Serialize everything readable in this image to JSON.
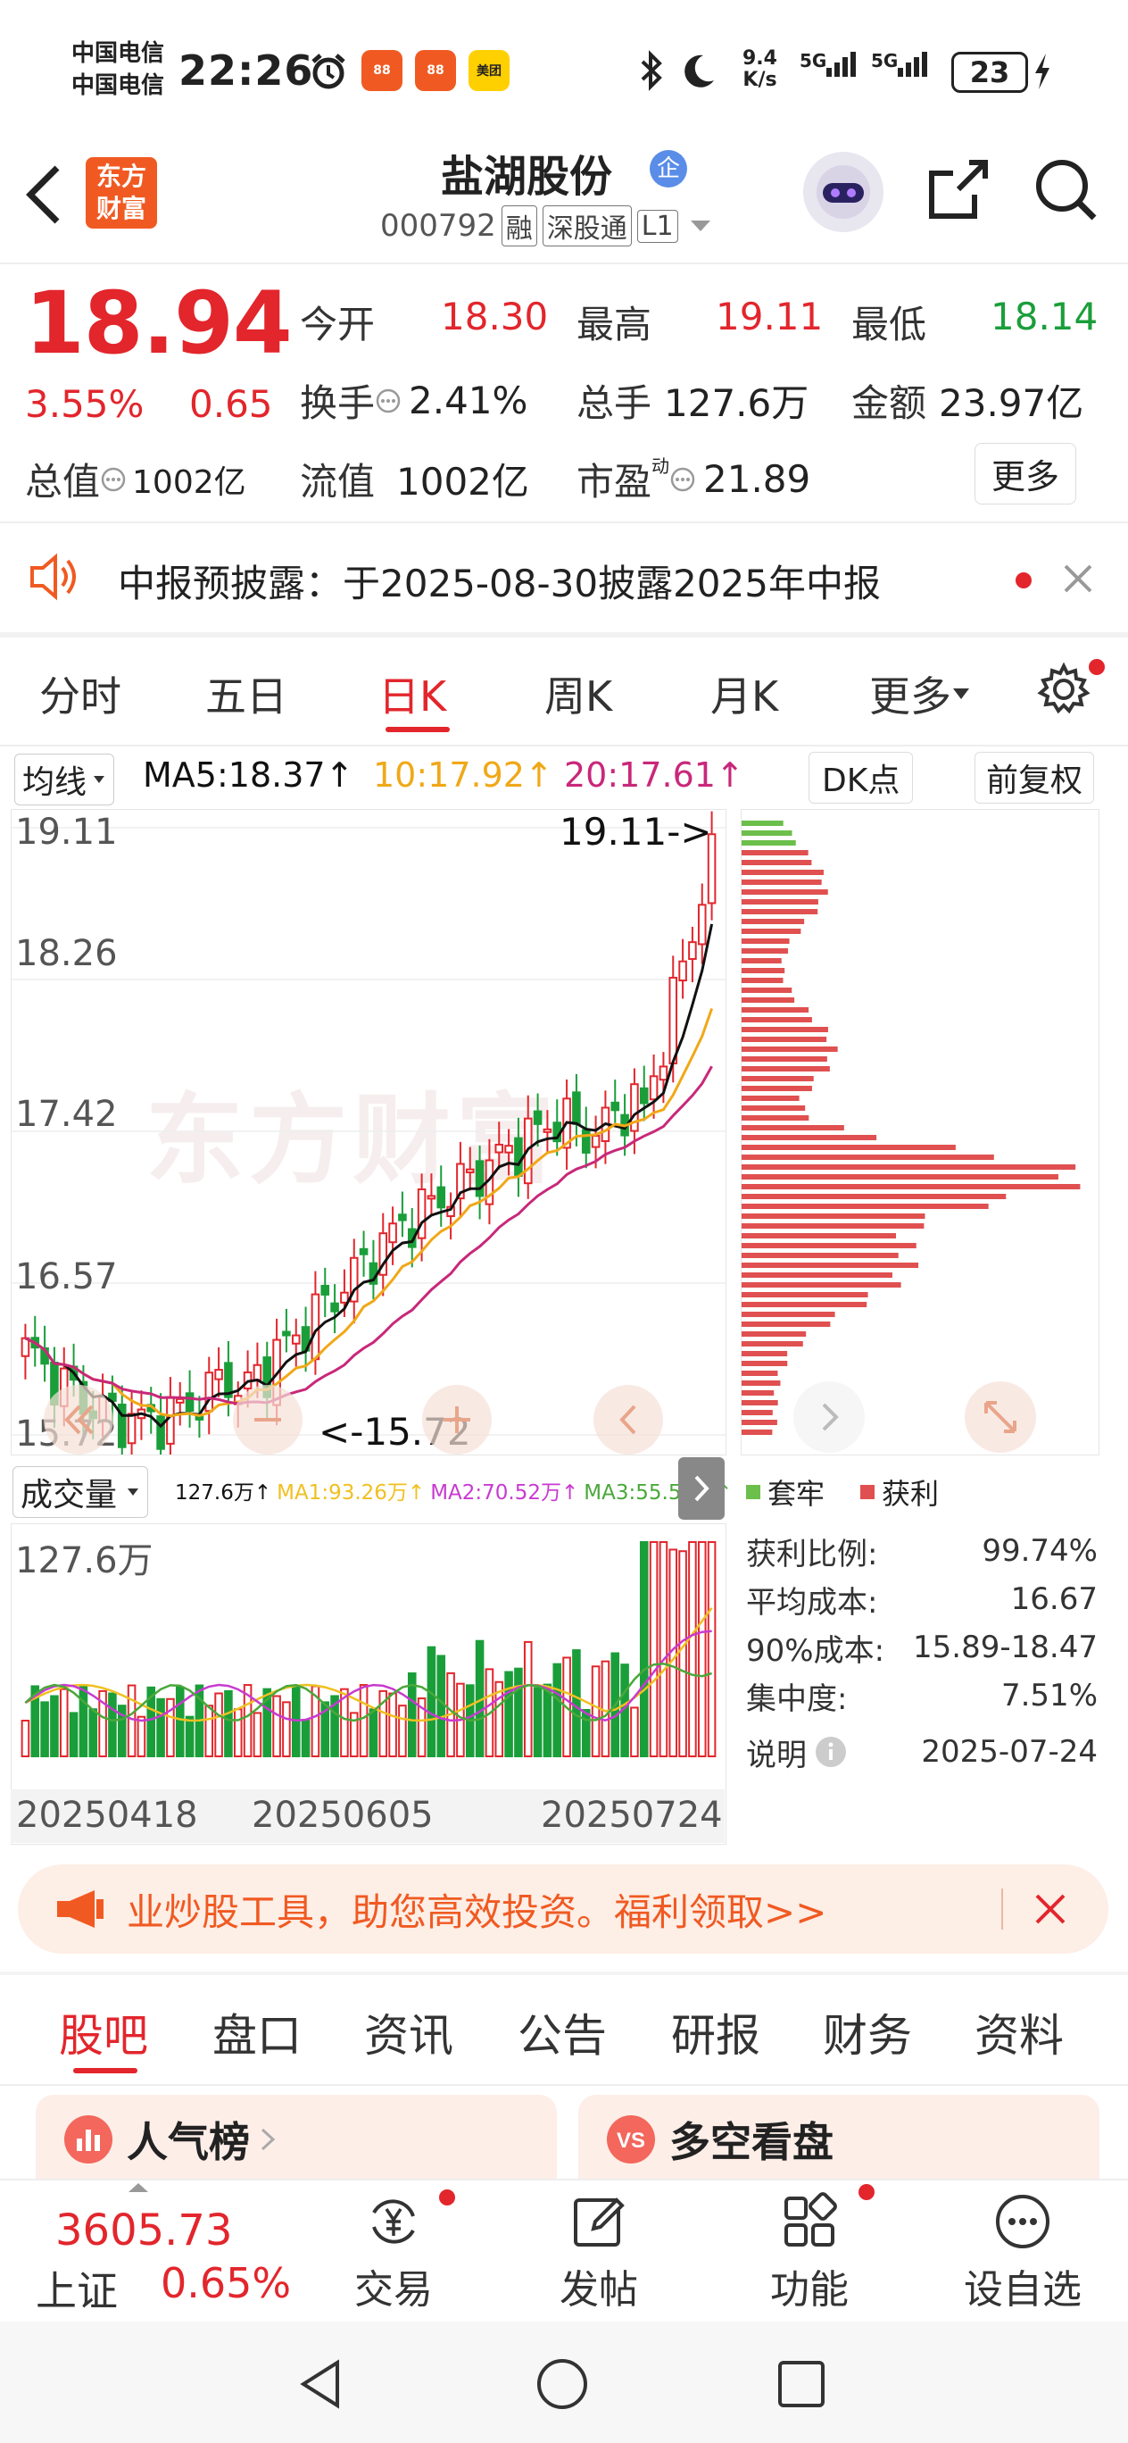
{
  "status_bar": {
    "carrier1": "中国电信",
    "carrier2": "中国电信",
    "time": "22:26",
    "app_icons": [
      "alarm-icon",
      "app1-icon",
      "app2-icon",
      "美团"
    ],
    "net_speed_top": "9.4",
    "net_speed_bottom": "K/s",
    "signal1": "5G",
    "signal2": "5G",
    "battery": "23"
  },
  "header": {
    "logo_line1": "东方",
    "logo_line2": "财富",
    "title": "盐湖股份",
    "badge": "企",
    "code": "000792",
    "tags": [
      "融",
      "深股通",
      "L1"
    ]
  },
  "quote": {
    "price": "18.94",
    "change_pct": "3.55%",
    "change": "0.65",
    "open_label": "今开",
    "open": "18.30",
    "high_label": "最高",
    "high": "19.11",
    "low_label": "最低",
    "low": "18.14",
    "turnover_label": "换手",
    "turnover": "2.41%",
    "volume_label": "总手",
    "volume": "127.6万",
    "amount_label": "金额",
    "amount": "23.97亿",
    "mktcap_label": "总值",
    "mktcap": "1002亿",
    "float_label": "流值",
    "float": "1002亿",
    "pe_label": "市盈",
    "pe_sup": "动",
    "pe": "21.89",
    "more_button": "更多"
  },
  "notice": {
    "text": "中报预披露：于2025-08-30披露2025年中报"
  },
  "kline_tabs": {
    "tabs": [
      "分时",
      "五日",
      "日K",
      "周K",
      "月K",
      "更多"
    ],
    "active": "日K"
  },
  "ma_bar": {
    "selector": "均线",
    "ma5": "MA5:18.37↑",
    "ma10": "10:17.92↑",
    "ma20": "20:17.61↑",
    "dk_button": "DK点",
    "adjust_button": "前复权"
  },
  "price_chart": {
    "y_labels": [
      "19.11",
      "18.26",
      "17.42",
      "16.57",
      "15.72"
    ],
    "high_marker": "19.11->",
    "low_marker": "<-15.72",
    "watermark": "东方财富"
  },
  "volume_bar": {
    "selector": "成交量",
    "vol": "127.6万↑",
    "ma1": "MA1:93.26万↑",
    "ma2": "MA2:70.52万↑",
    "ma3": "MA3:55.53万↑",
    "max_label": "127.6万",
    "dates": [
      "20250418",
      "20250605",
      "20250724"
    ]
  },
  "chip_panel": {
    "legend_trapped": "套牢",
    "legend_profit": "获利",
    "rows": [
      {
        "label": "获利比例:",
        "value": "99.74%"
      },
      {
        "label": "平均成本:",
        "value": "16.67"
      },
      {
        "label": "90%成本:",
        "value": "15.89-18.47"
      },
      {
        "label": "集中度:",
        "value": "7.51%"
      }
    ],
    "note_label": "说明",
    "date": "2025-07-24"
  },
  "promo": {
    "text": "业炒股工具，助您高效投资。福利领取>>"
  },
  "section_tabs": {
    "tabs": [
      "股吧",
      "盘口",
      "资讯",
      "公告",
      "研报",
      "财务",
      "资料"
    ],
    "active": "股吧"
  },
  "cards": {
    "card1": "人气榜",
    "card2": "多空看盘"
  },
  "bottom_nav": {
    "index_value": "3605.73",
    "index_name": "上证",
    "index_change": "0.65%",
    "items": [
      "交易",
      "发帖",
      "功能",
      "设自选"
    ]
  },
  "colors": {
    "up": "#e2262c",
    "down": "#1a9e3a",
    "ma5": "#111111",
    "ma10": "#f0a818",
    "ma20": "#c8287a"
  }
}
